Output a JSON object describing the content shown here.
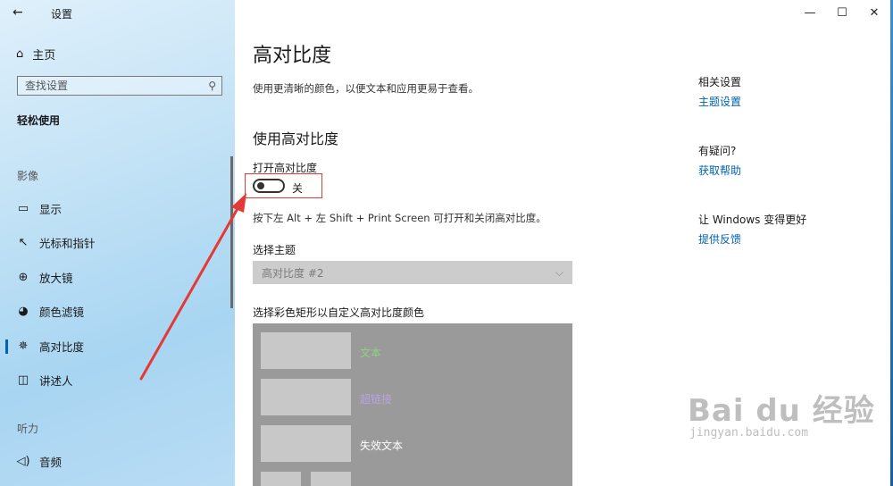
{
  "app": {
    "title": "设置",
    "back_icon": "back-arrow-icon"
  },
  "window": {
    "minimize": "—",
    "maximize": "☐",
    "close": "✕"
  },
  "sidebar": {
    "home_label": "主页",
    "search_placeholder": "查找设置",
    "category": "轻松使用",
    "section_vision": "影像",
    "items": [
      {
        "label": "显示",
        "icon": "monitor-icon"
      },
      {
        "label": "光标和指针",
        "icon": "cursor-icon"
      },
      {
        "label": "放大镜",
        "icon": "magnifier-icon"
      },
      {
        "label": "颜色滤镜",
        "icon": "palette-icon"
      },
      {
        "label": "高对比度",
        "icon": "contrast-icon",
        "selected": true
      },
      {
        "label": "讲述人",
        "icon": "narrator-icon"
      }
    ],
    "section_hearing": "听力",
    "hearing_items": [
      {
        "label": "音频",
        "icon": "speaker-icon"
      }
    ]
  },
  "main": {
    "title": "高对比度",
    "description": "使用更清晰的颜色，以便文本和应用更易于查看。",
    "section_title": "使用高对比度",
    "toggle_label": "打开高对比度",
    "toggle_state": "关",
    "toggle_on": false,
    "shortcut_hint": "按下左 Alt + 左 Shift + Print Screen 可打开和关闭高对比度。",
    "theme_label": "选择主题",
    "theme_value": "高对比度 #2",
    "color_label": "选择彩色矩形以自定义高对比度颜色",
    "swatches": [
      {
        "label": "文本",
        "color": "#8cd47e"
      },
      {
        "label": "超链接",
        "color": "#b9a3e3"
      },
      {
        "label": "失效文本",
        "color": "#ffffff"
      }
    ]
  },
  "related": {
    "heading": "相关设置",
    "theme_link": "主题设置",
    "help_heading": "有疑问?",
    "help_link": "获取帮助",
    "feedback_heading": "让 Windows 变得更好",
    "feedback_link": "提供反馈"
  },
  "annotation": {
    "color": "#e53935"
  },
  "watermark": {
    "brand": "Bai du 经验",
    "url": "jingyan.baidu.com"
  }
}
